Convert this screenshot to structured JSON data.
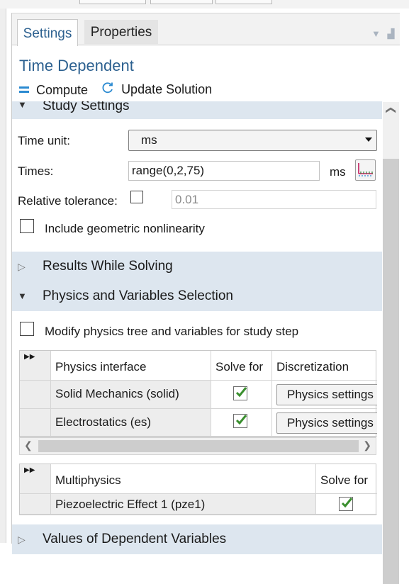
{
  "tabs": {
    "settings": "Settings",
    "properties": "Properties"
  },
  "title": "Time Dependent",
  "toolbar": {
    "compute": "Compute",
    "update_solution": "Update Solution"
  },
  "sections": {
    "study_settings": "Study Settings",
    "results_while_solving": "Results While Solving",
    "physics_selection": "Physics and Variables Selection",
    "values_dependent": "Values of Dependent Variables"
  },
  "study": {
    "time_unit_label": "Time unit:",
    "time_unit_value": "ms",
    "times_label": "Times:",
    "times_value": "range(0,2,75)",
    "times_unit": "ms",
    "rel_tol_label": "Relative tolerance:",
    "rel_tol_checked": false,
    "rel_tol_value": "0.01",
    "geom_nonlin_label": "Include geometric nonlinearity",
    "geom_nonlin_checked": false
  },
  "physics": {
    "modify_label": "Modify physics tree and variables for study step",
    "modify_checked": false,
    "columns": [
      "Physics interface",
      "Solve for",
      "Discretization"
    ],
    "rows": [
      {
        "name": "Solid Mechanics (solid)",
        "solve_for": true,
        "discretization": "Physics settings"
      },
      {
        "name": "Electrostatics (es)",
        "solve_for": true,
        "discretization": "Physics settings"
      }
    ],
    "multiphysics_columns": [
      "Multiphysics",
      "Solve for"
    ],
    "multiphysics_rows": [
      {
        "name": "Piezoelectric Effect 1 (pze1)",
        "solve_for": true
      }
    ]
  },
  "icons": {
    "compute": "compute-icon",
    "update": "refresh-icon",
    "range": "range-plot-icon",
    "expand_columns": "double-chevron-right-icon"
  },
  "colors": {
    "accent": "#2d6190",
    "section_bg": "#dde6ef",
    "check": "#3a8f2e"
  }
}
